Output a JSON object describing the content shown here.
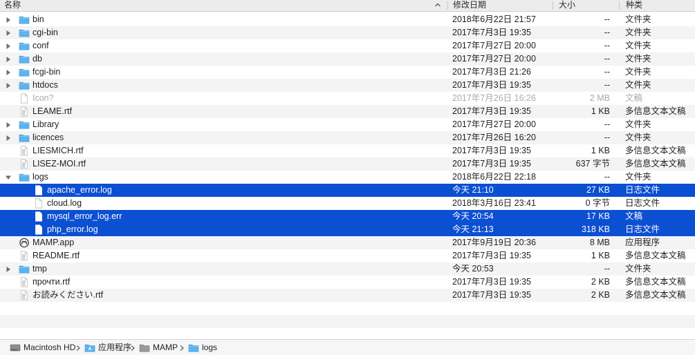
{
  "columns": {
    "name": "名称",
    "date": "修改日期",
    "size": "大小",
    "kind": "种类"
  },
  "rows": [
    {
      "name": "bin",
      "icon": "folder-icon",
      "disclosure": "collapsed",
      "indent": 0,
      "date": "2018年6月22日 21:57",
      "size": "--",
      "kind": "文件夹"
    },
    {
      "name": "cgi-bin",
      "icon": "folder-icon",
      "disclosure": "collapsed",
      "indent": 0,
      "date": "2017年7月3日 19:35",
      "size": "--",
      "kind": "文件夹"
    },
    {
      "name": "conf",
      "icon": "folder-icon",
      "disclosure": "collapsed",
      "indent": 0,
      "date": "2017年7月27日 20:00",
      "size": "--",
      "kind": "文件夹"
    },
    {
      "name": "db",
      "icon": "folder-icon",
      "disclosure": "collapsed",
      "indent": 0,
      "date": "2017年7月27日 20:00",
      "size": "--",
      "kind": "文件夹"
    },
    {
      "name": "fcgi-bin",
      "icon": "folder-icon",
      "disclosure": "collapsed",
      "indent": 0,
      "date": "2017年7月3日 21:26",
      "size": "--",
      "kind": "文件夹"
    },
    {
      "name": "htdocs",
      "icon": "folder-icon",
      "disclosure": "collapsed",
      "indent": 0,
      "date": "2017年7月3日 19:35",
      "size": "--",
      "kind": "文件夹"
    },
    {
      "name": "Icon?",
      "icon": "document-icon",
      "disclosure": "none",
      "indent": 0,
      "date": "2017年7月26日 16:26",
      "size": "2 MB",
      "kind": "文稿",
      "dim": true
    },
    {
      "name": "LEAME.rtf",
      "icon": "rtf-document-icon",
      "disclosure": "none",
      "indent": 0,
      "date": "2017年7月3日 19:35",
      "size": "1 KB",
      "kind": "多信息文本文稿"
    },
    {
      "name": "Library",
      "icon": "folder-icon",
      "disclosure": "collapsed",
      "indent": 0,
      "date": "2017年7月27日 20:00",
      "size": "--",
      "kind": "文件夹"
    },
    {
      "name": "licences",
      "icon": "folder-icon",
      "disclosure": "collapsed",
      "indent": 0,
      "date": "2017年7月26日 16:20",
      "size": "--",
      "kind": "文件夹"
    },
    {
      "name": "LIESMICH.rtf",
      "icon": "rtf-document-icon",
      "disclosure": "none",
      "indent": 0,
      "date": "2017年7月3日 19:35",
      "size": "1 KB",
      "kind": "多信息文本文稿"
    },
    {
      "name": "LISEZ-MOI.rtf",
      "icon": "rtf-document-icon",
      "disclosure": "none",
      "indent": 0,
      "date": "2017年7月3日 19:35",
      "size": "637 字节",
      "kind": "多信息文本文稿"
    },
    {
      "name": "logs",
      "icon": "folder-icon",
      "disclosure": "expanded",
      "indent": 0,
      "date": "2018年6月22日 22:18",
      "size": "--",
      "kind": "文件夹"
    },
    {
      "name": "apache_error.log",
      "icon": "document-icon",
      "disclosure": "none",
      "indent": 1,
      "date": "今天 21:10",
      "size": "27 KB",
      "kind": "日志文件",
      "selected": true
    },
    {
      "name": "cloud.log",
      "icon": "document-icon",
      "disclosure": "none",
      "indent": 1,
      "date": "2018年3月16日 23:41",
      "size": "0 字节",
      "kind": "日志文件"
    },
    {
      "name": "mysql_error_log.err",
      "icon": "document-icon",
      "disclosure": "none",
      "indent": 1,
      "date": "今天 20:54",
      "size": "17 KB",
      "kind": "文稿",
      "selected": true
    },
    {
      "name": "php_error.log",
      "icon": "document-icon",
      "disclosure": "none",
      "indent": 1,
      "date": "今天 21:13",
      "size": "318 KB",
      "kind": "日志文件",
      "selected": true
    },
    {
      "name": "MAMP.app",
      "icon": "app-icon",
      "disclosure": "none",
      "indent": 0,
      "date": "2017年9月19日 20:36",
      "size": "8 MB",
      "kind": "应用程序"
    },
    {
      "name": "README.rtf",
      "icon": "rtf-document-icon",
      "disclosure": "none",
      "indent": 0,
      "date": "2017年7月3日 19:35",
      "size": "1 KB",
      "kind": "多信息文本文稿"
    },
    {
      "name": "tmp",
      "icon": "folder-icon",
      "disclosure": "collapsed",
      "indent": 0,
      "date": "今天 20:53",
      "size": "--",
      "kind": "文件夹"
    },
    {
      "name": "прочти.rtf",
      "icon": "rtf-document-icon",
      "disclosure": "none",
      "indent": 0,
      "date": "2017年7月3日 19:35",
      "size": "2 KB",
      "kind": "多信息文本文稿"
    },
    {
      "name": "お読みください.rtf",
      "icon": "rtf-document-icon",
      "disclosure": "none",
      "indent": 0,
      "date": "2017年7月3日 19:35",
      "size": "2 KB",
      "kind": "多信息文本文稿"
    }
  ],
  "pathbar": [
    {
      "label": "Macintosh HD",
      "icon": "hard-drive-icon"
    },
    {
      "label": "应用程序",
      "icon": "applications-folder-icon"
    },
    {
      "label": "MAMP",
      "icon": "gray-folder-icon"
    },
    {
      "label": "logs",
      "icon": "folder-icon"
    }
  ],
  "colors": {
    "selection": "#0b4fd2",
    "folder": "#5bb4ef",
    "stripe": "#f4f4f4"
  }
}
